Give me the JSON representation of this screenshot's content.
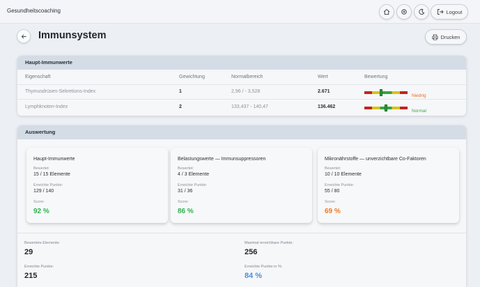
{
  "app": {
    "title": "Gesundheitscoaching",
    "logout_label": "Logout"
  },
  "header": {
    "title": "Immunsystem",
    "print_label": "Drucken"
  },
  "colors": {
    "green": "#2db24f",
    "orange": "#ee7a24",
    "blue": "#4a8fe0",
    "low": "#ee6b1e",
    "normal": "#35a94a"
  },
  "main_values": {
    "title": "Haupt-Immunwerte",
    "columns": [
      "Eigenschaft",
      "Gewichtung",
      "Normalbereich",
      "Wert",
      "Bewertung"
    ],
    "rows": [
      {
        "property": "Thymusdrüsen-Sekretions-Index",
        "weight": "1",
        "range": "2,96 / - 3,528",
        "value": "2.671",
        "rating": "Niedrig",
        "marker": 0.38
      },
      {
        "property": "Lymphknoten-Index",
        "weight": "2",
        "range": "133,437 - 140,47",
        "value": "136.462",
        "rating": "Normal",
        "marker": 0.5
      }
    ]
  },
  "evaluation": {
    "title": "Auswertung",
    "cards": [
      {
        "title": "Haupt-Immunwerte",
        "rated_label": "Bewertet:",
        "rated_value": "15 / 15 Elemente",
        "points_label": "Erreichte Punkte:",
        "points_value": "129 / 140",
        "score_label": "Score:",
        "score_value": "92 %",
        "score_color": "#2db24f"
      },
      {
        "title": "Belastungswerte — Immunsuppressoren",
        "rated_label": "Bewertet:",
        "rated_value": "4 / 3 Elemente",
        "points_label": "Erreichte Punkte:",
        "points_value": "31 / 36",
        "score_label": "Score:",
        "score_value": "86 %",
        "score_color": "#2db24f"
      },
      {
        "title": "Mikronährstoffe — unverzichtbare Co-Faktoren",
        "rated_label": "Bewertet:",
        "rated_value": "10 / 10 Elemente",
        "points_label": "Erreichte Punkte:",
        "points_value": "55 / 80",
        "score_label": "Score:",
        "score_value": "69 %",
        "score_color": "#ee7a24"
      }
    ],
    "summary": {
      "rated_elements_label": "Bewertete Elemente:",
      "rated_elements": "29",
      "max_points_label": "Maximal erreichbare Punkte:",
      "max_points": "256",
      "points_label": "Erreichte Punkte:",
      "points": "215",
      "percent_label": "Erreichte Punkte in %:",
      "percent": "84 %"
    }
  },
  "icons": [
    "home-icon",
    "settings-icon",
    "theme-icon",
    "logout-icon",
    "back-icon",
    "printer-icon"
  ]
}
